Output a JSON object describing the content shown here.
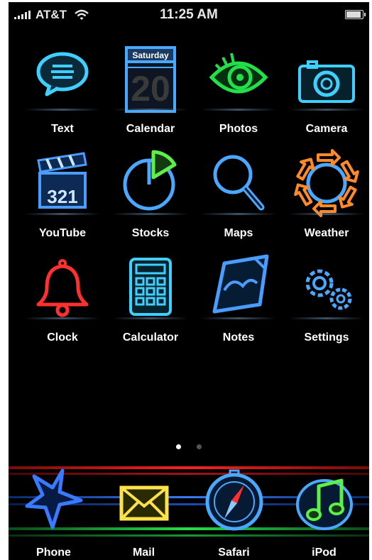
{
  "status": {
    "carrier": "AT&T",
    "time": "11:25 AM",
    "battery_level": 0.95
  },
  "calendar": {
    "weekday": "Saturday",
    "day": "20"
  },
  "youtube": {
    "clapper_number": "321"
  },
  "apps": [
    {
      "label": "Text",
      "icon": "speech-bubble-icon"
    },
    {
      "label": "Calendar",
      "icon": "calendar-icon"
    },
    {
      "label": "Photos",
      "icon": "eye-icon"
    },
    {
      "label": "Camera",
      "icon": "camera-icon"
    },
    {
      "label": "YouTube",
      "icon": "clapperboard-icon"
    },
    {
      "label": "Stocks",
      "icon": "pie-chart-icon"
    },
    {
      "label": "Maps",
      "icon": "magnifier-icon"
    },
    {
      "label": "Weather",
      "icon": "arrow-ring-icon"
    },
    {
      "label": "Clock",
      "icon": "bell-icon"
    },
    {
      "label": "Calculator",
      "icon": "calculator-icon"
    },
    {
      "label": "Notes",
      "icon": "notepad-icon"
    },
    {
      "label": "Settings",
      "icon": "gears-icon"
    }
  ],
  "page_indicator": {
    "pages": 2,
    "current": 1
  },
  "dock": [
    {
      "label": "Phone",
      "icon": "star-icon"
    },
    {
      "label": "Mail",
      "icon": "envelope-icon"
    },
    {
      "label": "Safari",
      "icon": "compass-icon"
    },
    {
      "label": "iPod",
      "icon": "music-note-icon"
    }
  ],
  "colors": {
    "background": "#000000",
    "neon_blue": "#3fb6ff",
    "neon_green": "#22e04a",
    "neon_orange": "#ff8a2a",
    "neon_red": "#ff3030",
    "neon_yellow": "#ffe24a"
  }
}
